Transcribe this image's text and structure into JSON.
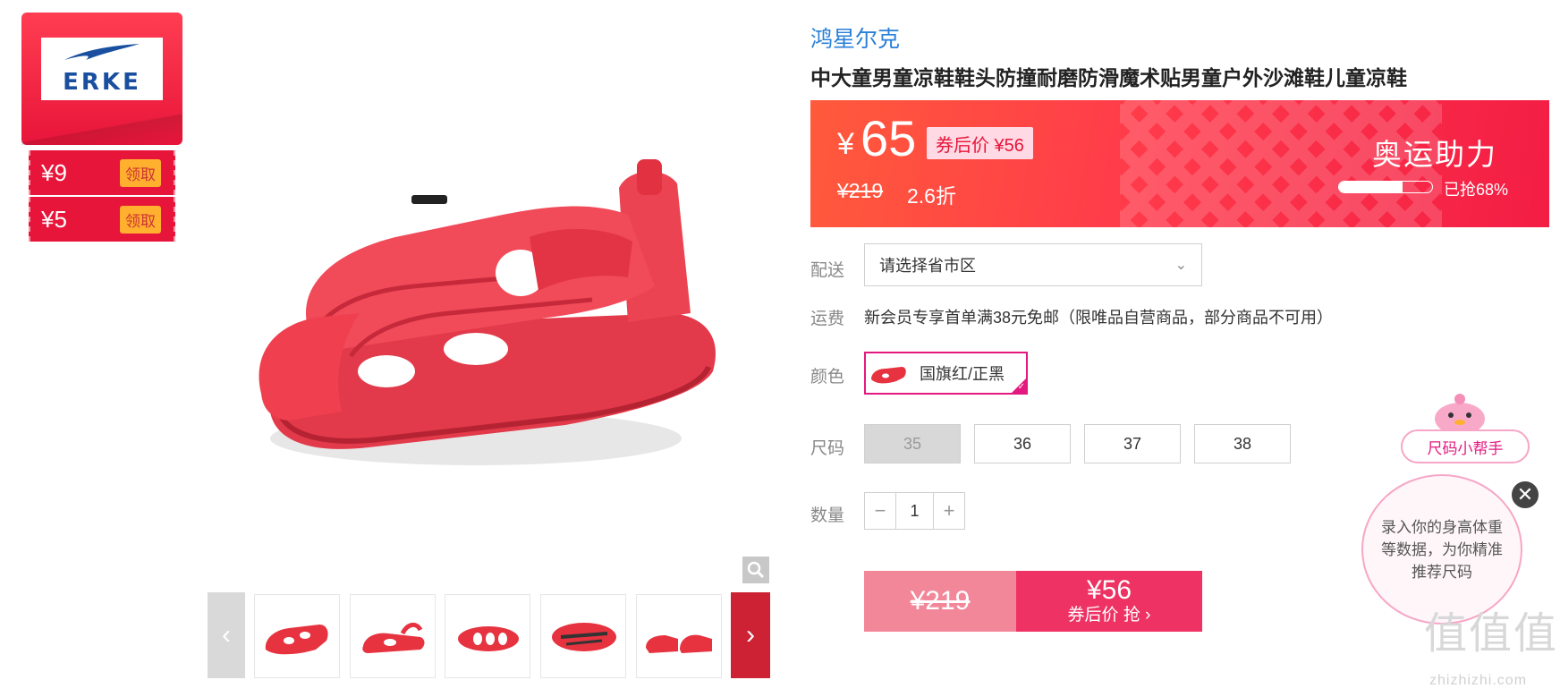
{
  "brand_card": {
    "logo_text": "ERKE"
  },
  "coupons": [
    {
      "amount": "¥9",
      "action": "领取"
    },
    {
      "amount": "¥5",
      "action": "领取"
    }
  ],
  "product": {
    "brand": "鸿星尔克",
    "title": "中大童男童凉鞋鞋头防撞耐磨防滑魔术贴男童户外沙滩鞋儿童凉鞋"
  },
  "price_banner": {
    "currency": "¥",
    "price": "65",
    "coupon_price": "券后价 ¥56",
    "original_price": "¥219",
    "discount": "2.6折",
    "promo_title": "奥运助力",
    "sold_fraction": 0.68,
    "sold_text": "已抢68%"
  },
  "delivery": {
    "label": "配送",
    "placeholder": "请选择省市区"
  },
  "shipping": {
    "label": "运费",
    "text": "新会员专享首单满38元免邮（限唯品自营商品，部分商品不可用）"
  },
  "color": {
    "label": "颜色",
    "option": "国旗红/正黑"
  },
  "size": {
    "label": "尺码",
    "options": [
      {
        "value": "35",
        "available": false
      },
      {
        "value": "36",
        "available": true
      },
      {
        "value": "37",
        "available": true
      },
      {
        "value": "38",
        "available": true
      }
    ]
  },
  "quantity": {
    "label": "数量",
    "value": "1",
    "minus": "−",
    "plus": "+"
  },
  "buy_button": {
    "original": "¥219",
    "price": "¥56",
    "subtitle": "券后价 抢 ›"
  },
  "size_helper": {
    "title": "尺码小帮手",
    "bubble": "录入你的身高体重等数据，为你精准推荐尺码",
    "close": "✕"
  },
  "watermark": {
    "text": "值值值",
    "sub": "zhizhizhi.com"
  },
  "colors": {
    "accent": "#ee3264",
    "brand_red": "#e8153a",
    "link": "#2a80d8",
    "selected_border": "#e4197f"
  }
}
